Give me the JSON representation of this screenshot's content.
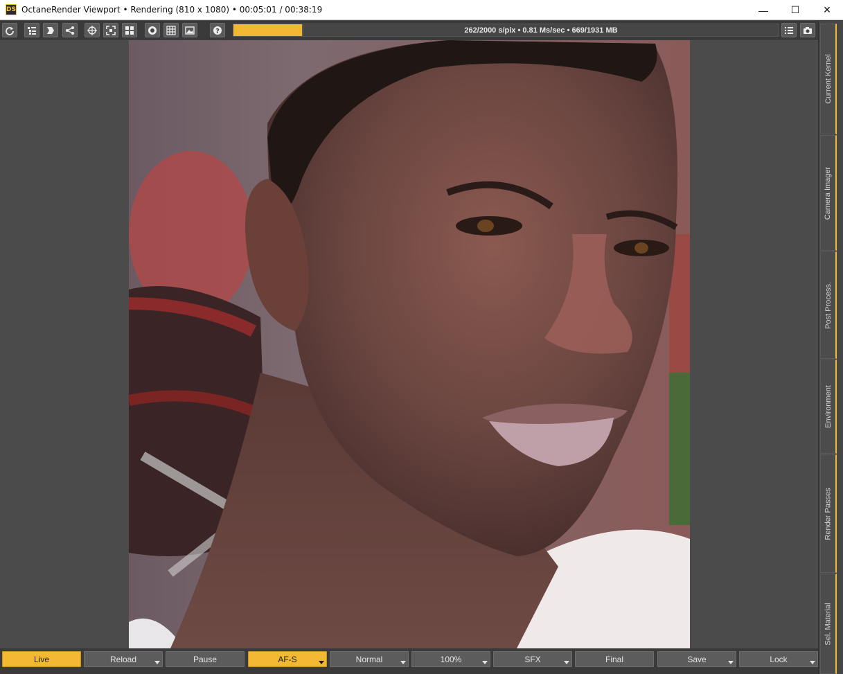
{
  "window": {
    "app_icon_text": "DS",
    "title": "OctaneRender Viewport • Rendering (810 x 1080) • 00:05:01 / 00:38:19",
    "minimize_glyph": "—",
    "maximize_glyph": "☐",
    "close_glyph": "✕"
  },
  "toolbar": {
    "buttons": [
      {
        "name": "refresh-icon"
      },
      {
        "name": "scene-outline-icon"
      },
      {
        "name": "export-icon"
      },
      {
        "name": "share-icon"
      },
      {
        "name": "target-icon"
      },
      {
        "name": "focus-frame-icon"
      },
      {
        "name": "grid-layout-icon"
      },
      {
        "name": "record-icon"
      },
      {
        "name": "grid-icon"
      },
      {
        "name": "image-icon"
      },
      {
        "name": "help-icon"
      }
    ],
    "progress": 1.0,
    "stats": "262/2000 s/pix • 0.81 Ms/sec • 669/1931 MB",
    "right_buttons": [
      {
        "name": "list-icon"
      },
      {
        "name": "camera-icon"
      }
    ]
  },
  "side_tabs": [
    {
      "label": "Current Kernel"
    },
    {
      "label": "Camera Imager"
    },
    {
      "label": "Post Process."
    },
    {
      "label": "Environment"
    },
    {
      "label": "Render Passes"
    },
    {
      "label": "Sel. Material"
    }
  ],
  "bottom_bar": {
    "buttons": [
      {
        "label": "Live",
        "active": true,
        "dropdown": false
      },
      {
        "label": "Reload",
        "active": false,
        "dropdown": true
      },
      {
        "label": "Pause",
        "active": false,
        "dropdown": false
      },
      {
        "label": "AF-S",
        "active": true,
        "dropdown": true
      },
      {
        "label": "Normal",
        "active": false,
        "dropdown": true
      },
      {
        "label": "100%",
        "active": false,
        "dropdown": true
      },
      {
        "label": "SFX",
        "active": false,
        "dropdown": true
      },
      {
        "label": "Final",
        "active": false,
        "dropdown": false
      },
      {
        "label": "Save",
        "active": false,
        "dropdown": true
      },
      {
        "label": "Lock",
        "active": false,
        "dropdown": true
      }
    ]
  },
  "colors": {
    "accent": "#f2b832",
    "panel": "#3a3a3a",
    "viewport": "#4b4b4b"
  }
}
